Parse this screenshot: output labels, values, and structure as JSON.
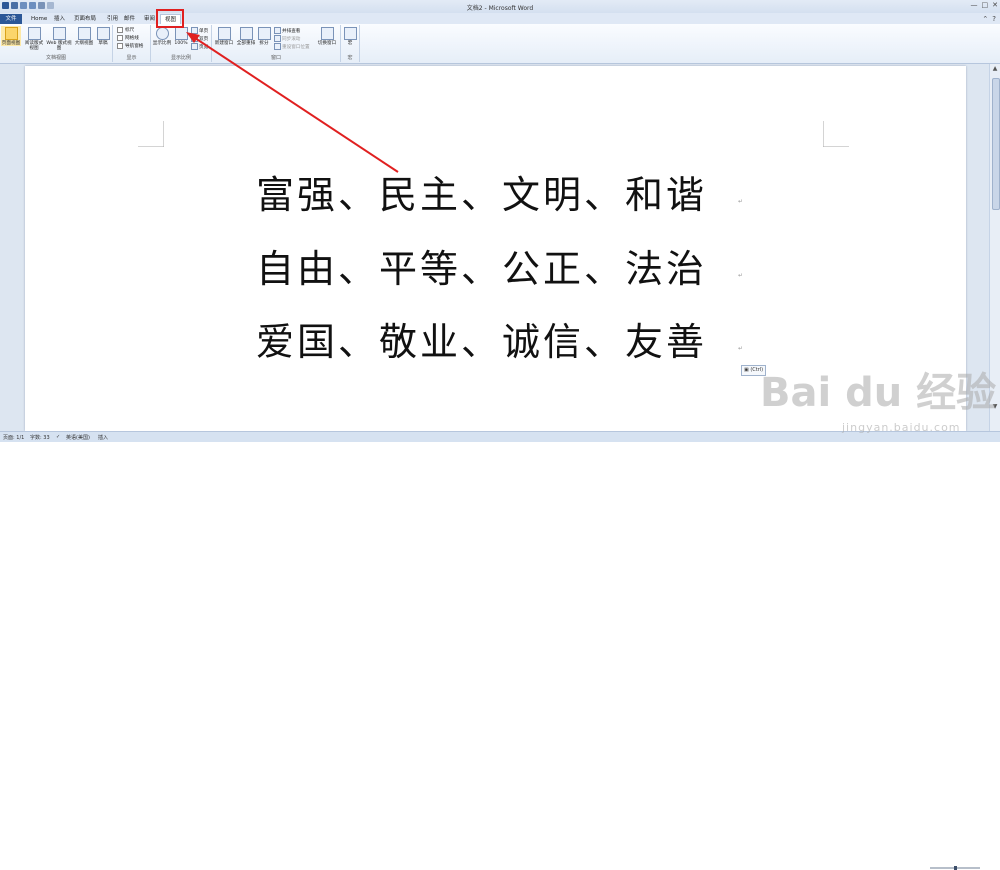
{
  "window": {
    "title": "文档2 - Microsoft Word",
    "minimize": "—",
    "maximize": "□",
    "close": "✕"
  },
  "tabs": [
    {
      "label": "文件",
      "name": "file"
    },
    {
      "label": "Home",
      "name": "home"
    },
    {
      "label": "插入",
      "name": "insert"
    },
    {
      "label": "页面布局",
      "name": "page-layout"
    },
    {
      "label": "引用",
      "name": "references"
    },
    {
      "label": "邮件",
      "name": "mailings"
    },
    {
      "label": "审阅",
      "name": "review"
    },
    {
      "label": "视图",
      "name": "view",
      "active": true
    }
  ],
  "ribbon": {
    "doc_views": {
      "label": "文档视图",
      "buttons": [
        "页面视图",
        "阅读版式视图",
        "Web 版式视图",
        "大纲视图",
        "草稿"
      ]
    },
    "show": {
      "label": "显示",
      "checks": [
        "标尺",
        "网格线",
        "导航窗格"
      ]
    },
    "zoom": {
      "label": "显示比例",
      "zoom_btn": "显示比例",
      "hundred": "100%",
      "small": [
        "单页",
        "双页",
        "页宽"
      ]
    },
    "window": {
      "label": "窗口",
      "new_window": "新建窗口",
      "arrange": "全部重排",
      "split": "拆分",
      "side_by_side": "并排查看",
      "sync_scroll": "同步滚动",
      "reset_pos": "重设窗口位置",
      "switch": "切换窗口"
    },
    "macros": {
      "label": "宏",
      "btn": "宏"
    }
  },
  "document": {
    "lines": [
      "富强、民主、文明、和谐",
      "自由、平等、公正、法治",
      "爱国、敬业、诚信、友善"
    ],
    "paragraph_mark": "↵",
    "paste_options": "(Ctrl)"
  },
  "status": {
    "page": "页面: 1/1",
    "words": "字数: 33",
    "lang": "英语(美国)",
    "mode": "插入"
  },
  "watermark": {
    "brand": "Bai du 经验",
    "url": "jingyan.baidu.com"
  },
  "colors": {
    "highlight": "#e02020",
    "file_tab": "#2b5797",
    "annotation_arrow": "#e02020"
  }
}
